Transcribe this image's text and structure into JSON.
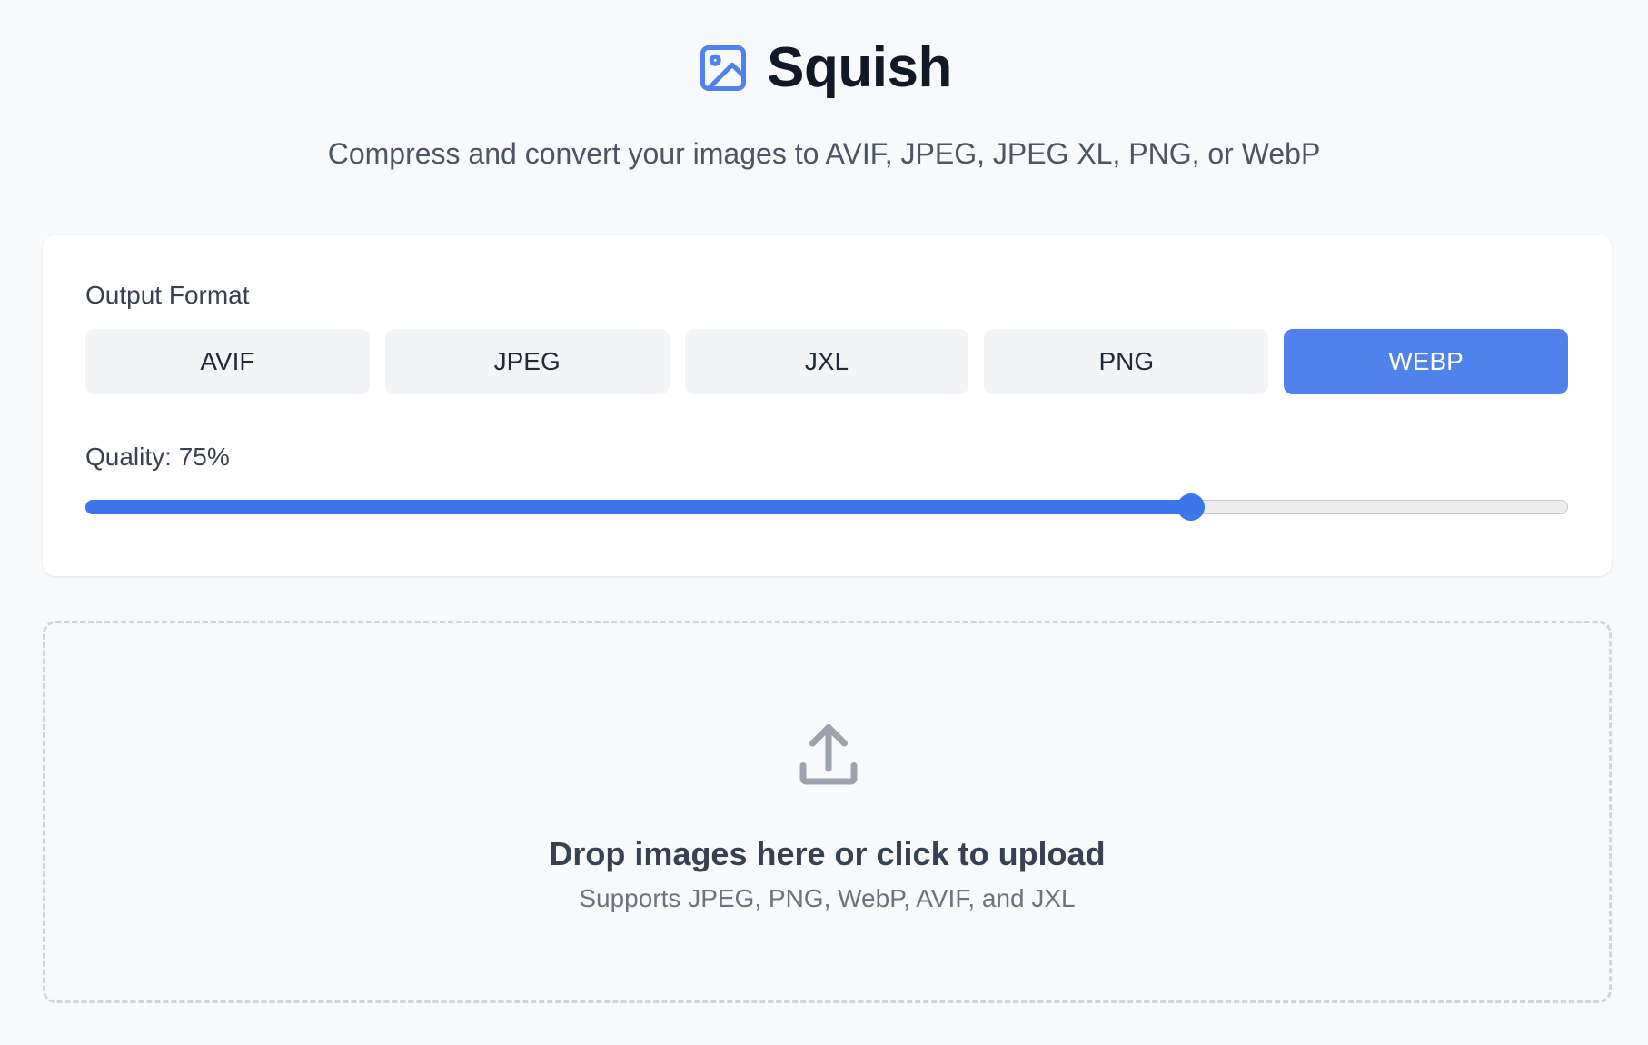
{
  "header": {
    "title": "Squish",
    "logo_icon": "image-icon",
    "subtitle": "Compress and convert your images to AVIF, JPEG, JPEG XL, PNG, or WebP"
  },
  "settings": {
    "format_label": "Output Format",
    "formats": [
      {
        "label": "AVIF",
        "active": false
      },
      {
        "label": "JPEG",
        "active": false
      },
      {
        "label": "JXL",
        "active": false
      },
      {
        "label": "PNG",
        "active": false
      },
      {
        "label": "WEBP",
        "active": true
      }
    ],
    "quality_label": "Quality: 75%",
    "quality_value": 75
  },
  "dropzone": {
    "icon": "upload-icon",
    "title": "Drop images here or click to upload",
    "hint": "Supports JPEG, PNG, WebP, AVIF, and JXL"
  },
  "colors": {
    "accent": "#4f82ed",
    "slider": "#3b76ec",
    "background": "#f8f9fa",
    "card": "#ffffff"
  }
}
